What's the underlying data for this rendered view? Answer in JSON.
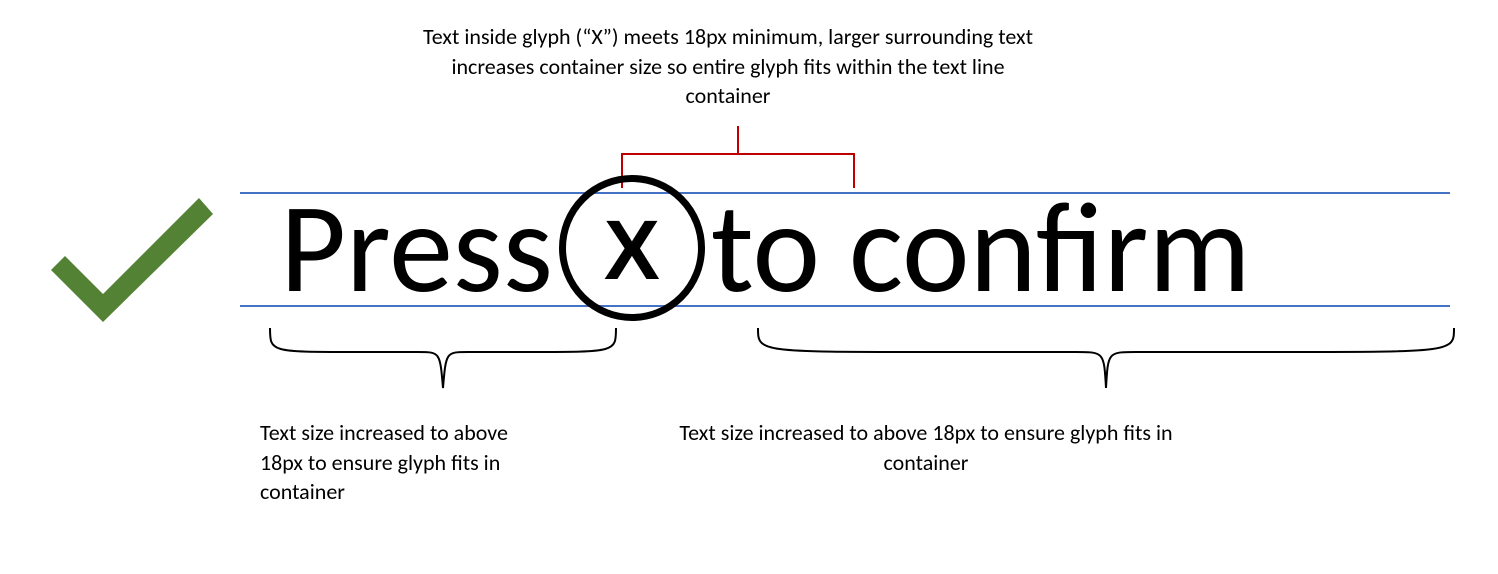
{
  "captions": {
    "top": "Text inside glyph (“X”) meets 18px minimum, larger surrounding text increases container size so entire glyph fits within the text line container",
    "left": "Text size increased to above 18px to ensure glyph fits in container",
    "right": "Text size increased to above 18px to ensure glyph fits in container"
  },
  "example": {
    "left_text": "Press",
    "glyph_letter": "X",
    "right_text": "to confirm"
  },
  "icons": {
    "check": "check-icon"
  },
  "colors": {
    "guide_line": "#4472c4",
    "accent_red": "#c00000",
    "check_green": "#548235"
  }
}
